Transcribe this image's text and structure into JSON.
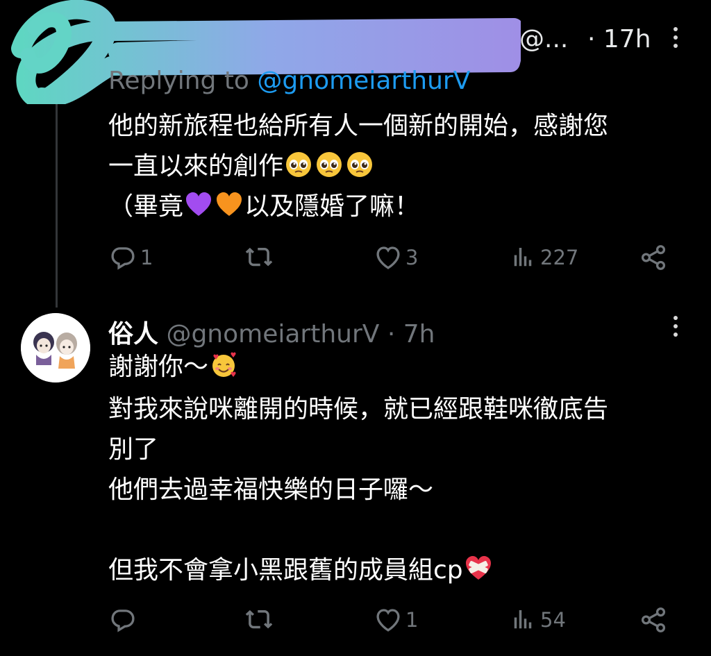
{
  "tweet1": {
    "handle_suffix": "@...",
    "time": "· 17h",
    "replying_prefix": "Replying to ",
    "replying_handle": "@gnomeiarthurV",
    "line1": "他的新旅程也給所有人一個新的開始，感謝您",
    "line2": "一直以來的創作",
    "line3_a": "（畢竟",
    "line3_b": "以及隱婚了嘛！",
    "stats": {
      "replies": "1",
      "retweets": "",
      "likes": "3",
      "views": "227"
    }
  },
  "tweet2": {
    "display_name": "俗人",
    "handle_time": " @gnomeiarthurV · 7h",
    "line1": "謝謝你～",
    "line2": "對我來說咪離開的時候，就已經跟鞋咪徹底告",
    "line3": "別了",
    "line4": "他們去過幸福快樂的日子囉～",
    "line5": "但我不會拿小黑跟舊的成員組cp",
    "stats": {
      "replies": "",
      "retweets": "",
      "likes": "1",
      "views": "54"
    }
  },
  "icons": {
    "reply": "reply-icon",
    "retweet": "retweet-icon",
    "like": "heart-icon",
    "views": "views-icon",
    "share": "share-icon",
    "more": "more-icon"
  },
  "colors": {
    "background": "#000000",
    "text": "#ffffff",
    "muted": "#71767b",
    "link": "#1d9bf0",
    "scribble": "#7ec6d6"
  }
}
